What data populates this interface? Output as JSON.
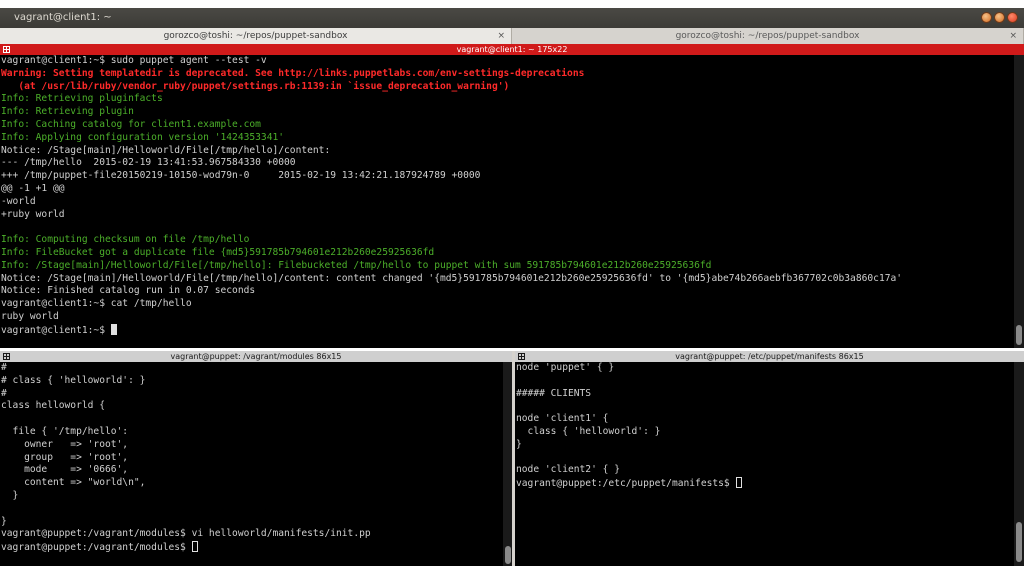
{
  "window": {
    "title": "vagrant@client1: ~"
  },
  "tabs": [
    {
      "label": "gorozco@toshi: ~/repos/puppet-sandbox",
      "close": "×"
    },
    {
      "label": "gorozco@toshi: ~/repos/puppet-sandbox",
      "close": "×"
    }
  ],
  "top_pane": {
    "title": "vagrant@client1: ~ 175x22",
    "lines": [
      {
        "text": "vagrant@client1:~$ sudo puppet agent --test -v",
        "color": "white"
      },
      {
        "text": "Warning: Setting templatedir is deprecated. See http://links.puppetlabs.com/env-settings-deprecations",
        "color": "red"
      },
      {
        "text": "   (at /usr/lib/ruby/vendor_ruby/puppet/settings.rb:1139:in `issue_deprecation_warning')",
        "color": "red"
      },
      {
        "text": "Info: Retrieving pluginfacts",
        "color": "green"
      },
      {
        "text": "Info: Retrieving plugin",
        "color": "green"
      },
      {
        "text": "Info: Caching catalog for client1.example.com",
        "color": "green"
      },
      {
        "text": "Info: Applying configuration version '1424353341'",
        "color": "green"
      },
      {
        "text": "Notice: /Stage[main]/Helloworld/File[/tmp/hello]/content:",
        "color": "white"
      },
      {
        "text": "--- /tmp/hello  2015-02-19 13:41:53.967584330 +0000",
        "color": "white"
      },
      {
        "text": "+++ /tmp/puppet-file20150219-10150-wod79n-0     2015-02-19 13:42:21.187924789 +0000",
        "color": "white"
      },
      {
        "text": "@@ -1 +1 @@",
        "color": "white"
      },
      {
        "text": "-world",
        "color": "white"
      },
      {
        "text": "+ruby world",
        "color": "white"
      },
      {
        "text": "",
        "color": "white"
      },
      {
        "text": "Info: Computing checksum on file /tmp/hello",
        "color": "green"
      },
      {
        "text": "Info: FileBucket got a duplicate file {md5}591785b794601e212b260e25925636fd",
        "color": "green"
      },
      {
        "text": "Info: /Stage[main]/Helloworld/File[/tmp/hello]: Filebucketed /tmp/hello to puppet with sum 591785b794601e212b260e25925636fd",
        "color": "green"
      },
      {
        "text": "Notice: /Stage[main]/Helloworld/File[/tmp/hello]/content: content changed '{md5}591785b794601e212b260e25925636fd' to '{md5}abe74b266aebfb367702c0b3a860c17a'",
        "color": "white"
      },
      {
        "text": "Notice: Finished catalog run in 0.07 seconds",
        "color": "white"
      },
      {
        "text": "vagrant@client1:~$ cat /tmp/hello",
        "color": "white"
      },
      {
        "text": "ruby world",
        "color": "white"
      },
      {
        "text": "vagrant@client1:~$ ",
        "color": "white",
        "cursor": "solid"
      }
    ]
  },
  "left_pane": {
    "title": "vagrant@puppet: /vagrant/modules 86x15",
    "lines": [
      {
        "text": "#",
        "color": "white"
      },
      {
        "text": "# class { 'helloworld': }",
        "color": "white"
      },
      {
        "text": "#",
        "color": "white"
      },
      {
        "text": "class helloworld {",
        "color": "white"
      },
      {
        "text": "",
        "color": "white"
      },
      {
        "text": "  file { '/tmp/hello':",
        "color": "white"
      },
      {
        "text": "    owner   => 'root',",
        "color": "white"
      },
      {
        "text": "    group   => 'root',",
        "color": "white"
      },
      {
        "text": "    mode    => '0666',",
        "color": "white"
      },
      {
        "text": "    content => \"world\\n\",",
        "color": "white"
      },
      {
        "text": "  }",
        "color": "white"
      },
      {
        "text": "",
        "color": "white"
      },
      {
        "text": "}",
        "color": "white"
      },
      {
        "text": "vagrant@puppet:/vagrant/modules$ vi helloworld/manifests/init.pp",
        "color": "white"
      },
      {
        "text": "vagrant@puppet:/vagrant/modules$ ",
        "color": "white",
        "cursor": "hollow"
      }
    ]
  },
  "right_pane": {
    "title": "vagrant@puppet: /etc/puppet/manifests 86x15",
    "lines": [
      {
        "text": "node 'puppet' { }",
        "color": "white"
      },
      {
        "text": "",
        "color": "white"
      },
      {
        "text": "##### CLIENTS",
        "color": "white"
      },
      {
        "text": "",
        "color": "white"
      },
      {
        "text": "node 'client1' {",
        "color": "white"
      },
      {
        "text": "  class { 'helloworld': }",
        "color": "white"
      },
      {
        "text": "}",
        "color": "white"
      },
      {
        "text": "",
        "color": "white"
      },
      {
        "text": "node 'client2' { }",
        "color": "white"
      },
      {
        "text": "vagrant@puppet:/etc/puppet/manifests$ ",
        "color": "white",
        "cursor": "hollow"
      }
    ]
  },
  "colors": {
    "active_title": "#d01a1a",
    "terminal_bg": "#000000",
    "warning": "#ff2a2a",
    "info": "#4caf2a"
  }
}
